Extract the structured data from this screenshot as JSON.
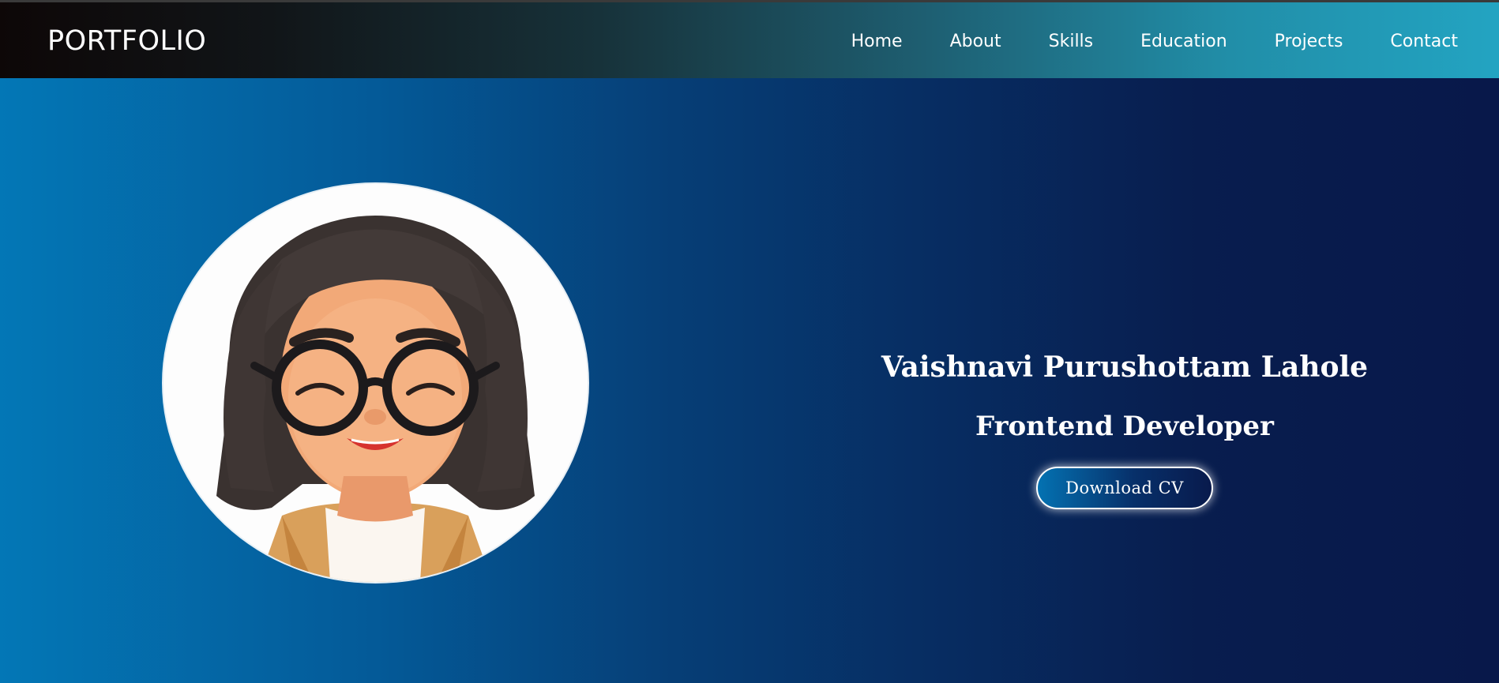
{
  "navbar": {
    "logo": "PORTFOLIO",
    "links": [
      "Home",
      "About",
      "Skills",
      "Education",
      "Projects",
      "Contact"
    ]
  },
  "hero": {
    "name": "Vaishnavi Purushottam Lahole",
    "role": "Frontend Developer",
    "cta_label": "Download CV",
    "avatar_icon": "avatar-illustration"
  },
  "colors": {
    "nav_start": "#0d0707",
    "nav_end": "#23a4c2",
    "hero_start": "#0377b6",
    "hero_end": "#08184a",
    "text": "#ffffff"
  }
}
